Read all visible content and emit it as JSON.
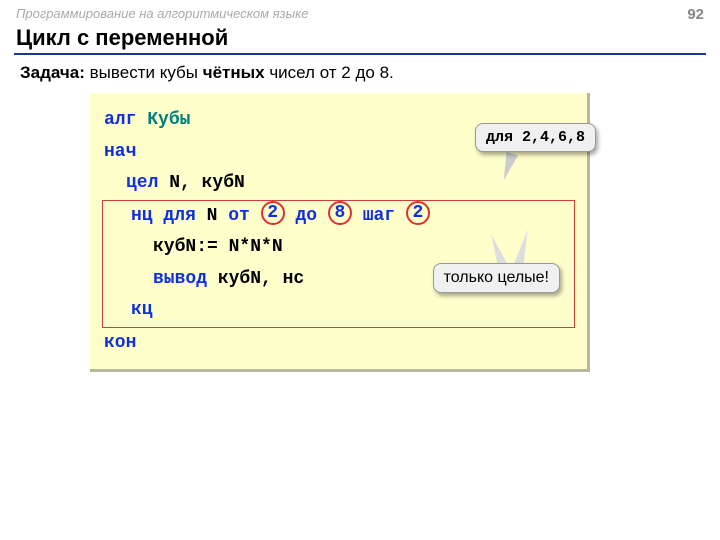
{
  "header": {
    "course": "Программирование на алгоритмическом языке",
    "page": "92"
  },
  "title": "Цикл с переменной",
  "task": {
    "label": "Задача:",
    "before": " вывести кубы ",
    "bold": "чётных",
    "after": " чисел от 2 до 8."
  },
  "code": {
    "l1_kw": "алг ",
    "l1_name": "Кубы",
    "l2": "нач",
    "l3_kw": "цел",
    "l3_rest": " N, кубN",
    "l4_a": "нц для",
    "l4_b": " N ",
    "l4_c": "от",
    "l4_d": " ",
    "l4_from": "2",
    "l4_e": " ",
    "l4_f": "до",
    "l4_g": " ",
    "l4_to": "8",
    "l4_h": " ",
    "l4_i": "шаг",
    "l4_j": " ",
    "l4_step": "2",
    "l5": "кубN:= N*N*N",
    "l6_a": "вывод",
    "l6_b": " кубN, нс",
    "l7": "кц",
    "l8": "кон"
  },
  "callouts": {
    "top": "для 2,4,6,8",
    "bot": "только целые!"
  }
}
